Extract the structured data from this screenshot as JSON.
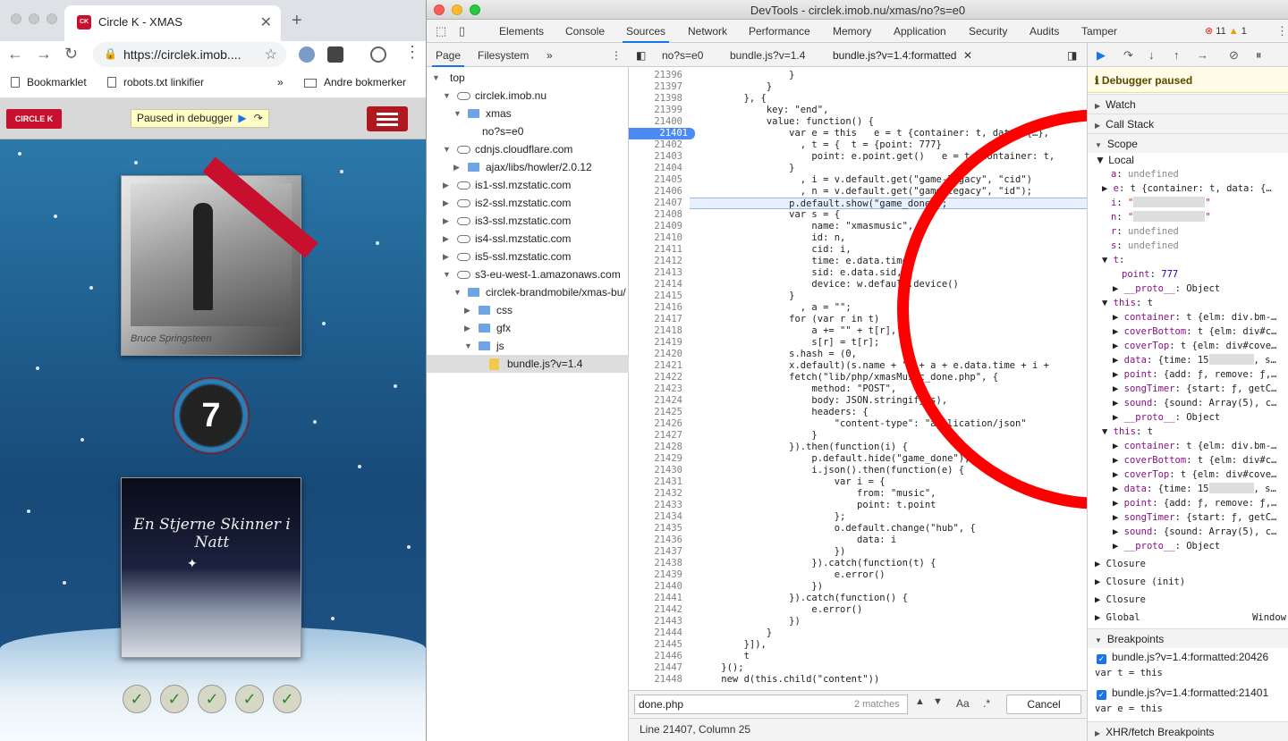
{
  "browser": {
    "tab_title": "Circle K - XMAS",
    "url": "https://circlek.imob....",
    "bookmarks": [
      "Bookmarklet",
      "robots.txt linkifier",
      "Andre bokmerker"
    ],
    "bookmarks_more": "»"
  },
  "page": {
    "logo_text": "CIRCLE K",
    "paused_badge": "Paused in debugger",
    "counter": "7",
    "cover1_signature": "Bruce Springsteen",
    "cover2_title": "En Stjerne Skinner i Natt",
    "checks": [
      "✓",
      "✓",
      "✓",
      "✓",
      "✓"
    ]
  },
  "devtools": {
    "window_title": "DevTools - circlek.imob.nu/xmas/no?s=e0",
    "tabs": [
      "Elements",
      "Console",
      "Sources",
      "Network",
      "Performance",
      "Memory",
      "Application",
      "Security",
      "Audits",
      "Tamper"
    ],
    "active_tab": "Sources",
    "errors": "11",
    "warnings": "1",
    "navigator": {
      "tabs": [
        "Page",
        "Filesystem"
      ],
      "more": "»",
      "tree": [
        {
          "label": "top",
          "kind": "frame",
          "indent": 0,
          "arrow": "▼"
        },
        {
          "label": "circlek.imob.nu",
          "kind": "cloud",
          "indent": 1,
          "arrow": "▼"
        },
        {
          "label": "xmas",
          "kind": "folder",
          "indent": 2,
          "arrow": "▼"
        },
        {
          "label": "no?s=e0",
          "kind": "file",
          "indent": 3,
          "arrow": ""
        },
        {
          "label": "cdnjs.cloudflare.com",
          "kind": "cloud",
          "indent": 1,
          "arrow": "▼"
        },
        {
          "label": "ajax/libs/howler/2.0.12",
          "kind": "folder",
          "indent": 2,
          "arrow": "▶"
        },
        {
          "label": "is1-ssl.mzstatic.com",
          "kind": "cloud",
          "indent": 1,
          "arrow": "▶"
        },
        {
          "label": "is2-ssl.mzstatic.com",
          "kind": "cloud",
          "indent": 1,
          "arrow": "▶"
        },
        {
          "label": "is3-ssl.mzstatic.com",
          "kind": "cloud",
          "indent": 1,
          "arrow": "▶"
        },
        {
          "label": "is4-ssl.mzstatic.com",
          "kind": "cloud",
          "indent": 1,
          "arrow": "▶"
        },
        {
          "label": "is5-ssl.mzstatic.com",
          "kind": "cloud",
          "indent": 1,
          "arrow": "▶"
        },
        {
          "label": "s3-eu-west-1.amazonaws.com",
          "kind": "cloud",
          "indent": 1,
          "arrow": "▼"
        },
        {
          "label": "circlek-brandmobile/xmas-bu/",
          "kind": "folder",
          "indent": 2,
          "arrow": "▼"
        },
        {
          "label": "css",
          "kind": "folder",
          "indent": 3,
          "arrow": "▶"
        },
        {
          "label": "gfx",
          "kind": "folder",
          "indent": 3,
          "arrow": "▶"
        },
        {
          "label": "js",
          "kind": "folder",
          "indent": 3,
          "arrow": "▼"
        },
        {
          "label": "bundle.js?v=1.4",
          "kind": "jsfile",
          "indent": 4,
          "arrow": "",
          "selected": true
        }
      ]
    },
    "editor": {
      "tabs": [
        "no?s=e0",
        "bundle.js?v=1.4",
        "bundle.js?v=1.4:formatted"
      ],
      "active_tab": "bundle.js?v=1.4:formatted",
      "breakpoint_line": "21401",
      "current_line": "21407",
      "search_value": "done.php",
      "search_matches": "2 matches",
      "match_case": "Aa",
      "regex": ".*",
      "cancel": "Cancel",
      "status": "Line 21407, Column 25"
    },
    "sidebar": {
      "paused": "Debugger paused",
      "sections": [
        "Watch",
        "Call Stack",
        "Scope"
      ],
      "local_label": "Local",
      "closures": [
        "Closure",
        "Closure (init)",
        "Closure"
      ],
      "global_label": "Global",
      "global_value": "Window",
      "breakpoints_label": "Breakpoints",
      "breakpoints": [
        {
          "file": "bundle.js?v=1.4:formatted:20426",
          "code": "var t = this"
        },
        {
          "file": "bundle.js?v=1.4:formatted:21401",
          "code": "var e = this"
        }
      ],
      "xhr_label": "XHR/fetch Breakpoints"
    }
  }
}
